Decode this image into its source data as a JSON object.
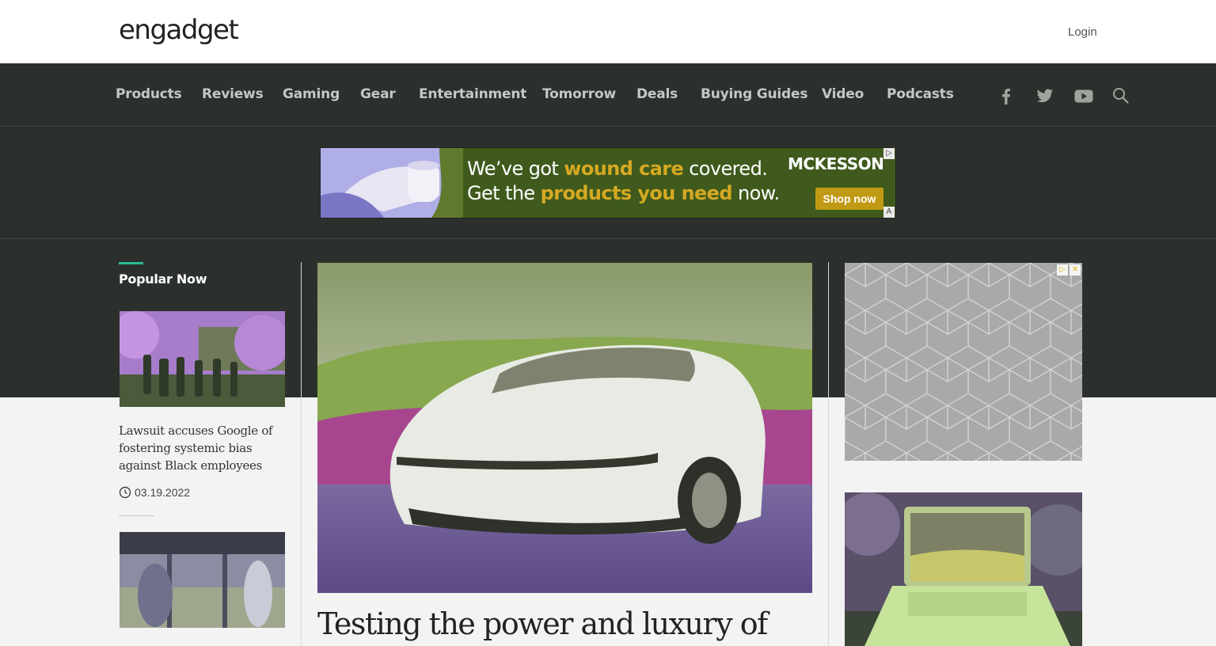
{
  "header": {
    "logo": "engadget",
    "login_label": "Login"
  },
  "nav": {
    "items": [
      "Products",
      "Reviews",
      "Gaming",
      "Gear",
      "Entertainment",
      "Tomorrow",
      "Deals",
      "Buying Guides",
      "Video",
      "Podcasts"
    ],
    "social_icons": [
      "facebook-icon",
      "twitter-icon",
      "youtube-icon",
      "search-icon"
    ]
  },
  "banner_ad": {
    "line1_pre": "We’ve got ",
    "line1_highlight": "wound care",
    "line1_post": " covered.",
    "line2_pre": "Get the ",
    "line2_highlight": "products you need",
    "line2_post": " now.",
    "brand": "MCKESSON",
    "cta": "Shop now",
    "ad_badge": "A"
  },
  "popular": {
    "heading": "Popular Now",
    "stories": [
      {
        "title": "Lawsuit accuses Google of fostering systemic bias against Black employees",
        "date": "03.19.2022"
      }
    ]
  },
  "hero": {
    "headline": "Testing the power and luxury of"
  },
  "colors": {
    "dark_band": "#2c302d",
    "accent": "#2bbd97",
    "highlight": "#d5a922",
    "cta": "#c09a14"
  }
}
